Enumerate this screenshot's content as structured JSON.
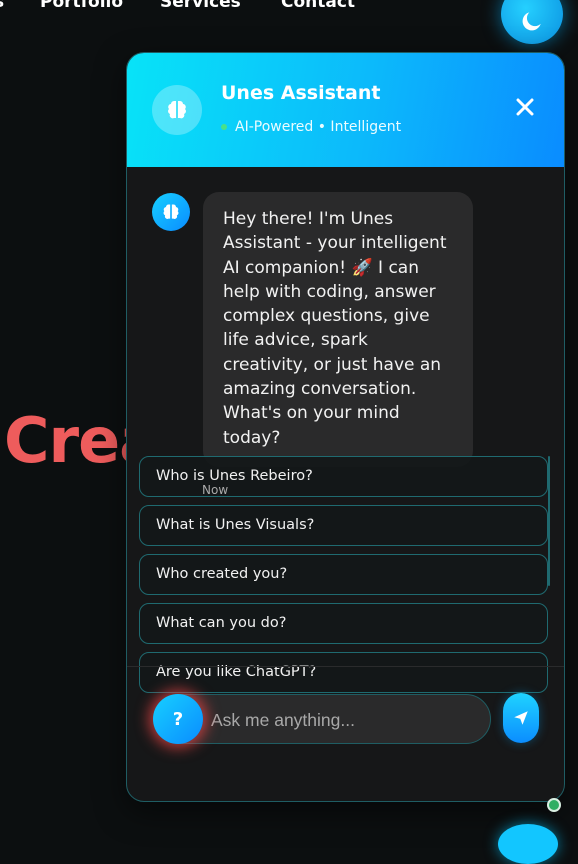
{
  "nav": {
    "items": [
      "s",
      "Portfolio",
      "Services",
      "Contact"
    ]
  },
  "hero": {
    "partial_word": "Crea"
  },
  "chat": {
    "title": "Unes Assistant",
    "status": "AI-Powered • Intelligent",
    "message": "Hey there! I'm Unes Assistant - your intelligent AI companion! 🚀 I can help with coding, answer complex questions, give life advice, spark creativity, or just have an amazing conversation. What's on your mind today?",
    "message_time": "Now",
    "suggestions": [
      "Who is Unes Rebeiro?",
      "What is Unes Visuals?",
      "Who created you?",
      "What can you do?",
      "Are you like ChatGPT?"
    ],
    "input_placeholder": "Ask me anything...",
    "help_label": "?"
  },
  "colors": {
    "accent": "#0cb9fb",
    "hero_text": "#ee5c5c",
    "panel_bg": "#161718",
    "bubble_bg": "#2a2a2b",
    "online": "#49e089"
  },
  "icons": [
    "moon-icon",
    "brain-icon",
    "close-icon",
    "send-icon"
  ]
}
